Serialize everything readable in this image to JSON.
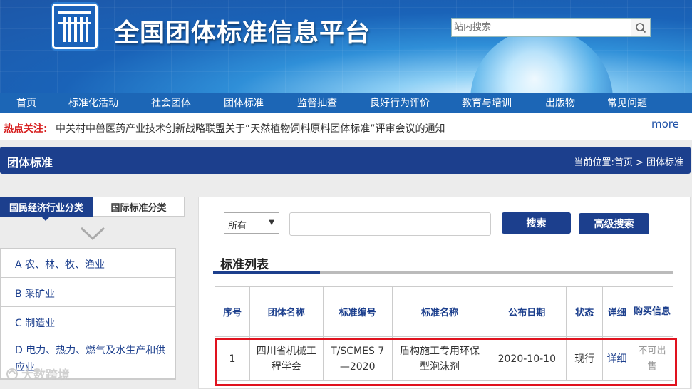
{
  "site": {
    "title": "全国团体标准信息平台"
  },
  "search": {
    "placeholder": "站内搜索"
  },
  "nav": [
    "首页",
    "标准化活动",
    "社会团体",
    "团体标准",
    "监督抽查",
    "良好行为评价",
    "教育与培训",
    "出版物",
    "常见问题"
  ],
  "hot": {
    "label": "热点关注:",
    "text": "中关村中兽医药产业技术创新战略联盟关于“天然植物饲料原料团体标准”评审会议的通知",
    "more": "more"
  },
  "section": {
    "title": "团体标准",
    "breadcrumb": "当前位置:首页 > 团体标准"
  },
  "sidebar": {
    "tabs": [
      "国民经济行业分类",
      "国际标准分类"
    ],
    "categories": [
      "A 农、林、牧、渔业",
      "B 采矿业",
      "C 制造业",
      "D 电力、热力、燃气及水生产和供应业"
    ]
  },
  "filter": {
    "select_value": "所有",
    "search_label": "搜索",
    "advanced_label": "高级搜索"
  },
  "list": {
    "title": "标准列表",
    "headers": [
      "序号",
      "团体名称",
      "标准编号",
      "标准名称",
      "公布日期",
      "状态",
      "详细",
      "购买信息"
    ],
    "rows": [
      [
        "1",
        "四川省机械工程学会",
        "T/SCMES 7—2020",
        "盾构施工专用环保型泡沫剂",
        "2020-10-10",
        "现行",
        "详细",
        "不可出售"
      ]
    ]
  },
  "watermark": "大数跨境",
  "colors": {
    "primary": "#1c3f8d",
    "nav": "#1c66b6",
    "hot_label": "#d71f1f",
    "highlight": "#e0121e"
  }
}
